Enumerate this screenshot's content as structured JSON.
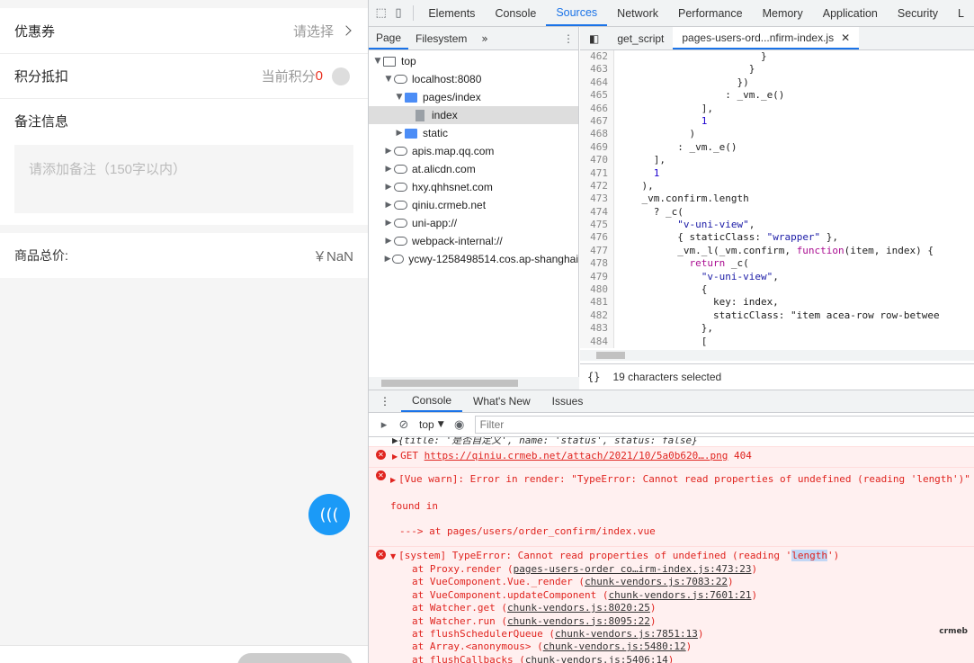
{
  "app": {
    "coupon": {
      "label": "优惠券",
      "value": "请选择"
    },
    "points": {
      "label": "积分抵扣",
      "prefix": "当前积分",
      "value": "0"
    },
    "remark": {
      "title": "备注信息",
      "placeholder": "请添加备注（150字以内）"
    },
    "total": {
      "label": "商品总价:",
      "value": "￥NaN"
    }
  },
  "devtools": {
    "tabs": [
      "Elements",
      "Console",
      "Sources",
      "Network",
      "Performance",
      "Memory",
      "Application",
      "Security",
      "L"
    ],
    "navigator": {
      "tabs": [
        "Page",
        "Filesystem"
      ],
      "tree": [
        {
          "label": "top",
          "depth": 0,
          "icon": "frame",
          "arrow": "▼"
        },
        {
          "label": "localhost:8080",
          "depth": 1,
          "icon": "cloud",
          "arrow": "▼"
        },
        {
          "label": "pages/index",
          "depth": 2,
          "icon": "folder",
          "arrow": "▼"
        },
        {
          "label": "index",
          "depth": 3,
          "icon": "file",
          "arrow": "",
          "selected": true
        },
        {
          "label": "static",
          "depth": 2,
          "icon": "folder",
          "arrow": "▶"
        },
        {
          "label": "apis.map.qq.com",
          "depth": 1,
          "icon": "cloud",
          "arrow": "▶"
        },
        {
          "label": "at.alicdn.com",
          "depth": 1,
          "icon": "cloud",
          "arrow": "▶"
        },
        {
          "label": "hxy.qhhsnet.com",
          "depth": 1,
          "icon": "cloud",
          "arrow": "▶"
        },
        {
          "label": "qiniu.crmeb.net",
          "depth": 1,
          "icon": "cloud",
          "arrow": "▶"
        },
        {
          "label": "uni-app://",
          "depth": 1,
          "icon": "cloud",
          "arrow": "▶"
        },
        {
          "label": "webpack-internal://",
          "depth": 1,
          "icon": "cloud",
          "arrow": "▶"
        },
        {
          "label": "ycwy-1258498514.cos.ap-shanghai",
          "depth": 1,
          "icon": "cloud",
          "arrow": "▶"
        }
      ]
    },
    "editor": {
      "tabs": [
        "get_script",
        "pages-users-ord...nfirm-index.js"
      ],
      "lines": [
        {
          "n": "462",
          "t": "                        }"
        },
        {
          "n": "463",
          "t": "                      }"
        },
        {
          "n": "464",
          "t": "                    })"
        },
        {
          "n": "465",
          "t": "                  : _vm._e()"
        },
        {
          "n": "466",
          "t": "              ],"
        },
        {
          "n": "467",
          "t": "              1"
        },
        {
          "n": "468",
          "t": "            )"
        },
        {
          "n": "469",
          "t": "          : _vm._e()"
        },
        {
          "n": "470",
          "t": "      ],"
        },
        {
          "n": "471",
          "t": "      1"
        },
        {
          "n": "472",
          "t": "    ),"
        },
        {
          "n": "473",
          "t": "    _vm.confirm.length"
        },
        {
          "n": "474",
          "t": "      ? _c("
        },
        {
          "n": "475",
          "t": "          \"v-uni-view\","
        },
        {
          "n": "476",
          "t": "          { staticClass: \"wrapper\" },"
        },
        {
          "n": "477",
          "t": "          _vm._l(_vm.confirm, function(item, index) {"
        },
        {
          "n": "478",
          "t": "            return _c("
        },
        {
          "n": "479",
          "t": "              \"v-uni-view\","
        },
        {
          "n": "480",
          "t": "              {"
        },
        {
          "n": "481",
          "t": "                key: index,"
        },
        {
          "n": "482",
          "t": "                staticClass: \"item acea-row row-betwee"
        },
        {
          "n": "483",
          "t": "              },"
        },
        {
          "n": "484",
          "t": "              ["
        }
      ],
      "status": "19 characters selected",
      "status_icon": "{}"
    },
    "drawer": {
      "tabs": [
        "Console",
        "What's New",
        "Issues"
      ],
      "context": "top",
      "filter_placeholder": "Filter",
      "messages": {
        "m0": "▶{title: '是否自定义', name: 'status', status: false}",
        "m1_pre": "GET ",
        "m1_url": "https://qiniu.crmeb.net/attach/2021/10/5a0b620….png",
        "m1_post": " 404",
        "m2": "[Vue warn]: Error in render: \"TypeError: Cannot read properties of undefined (reading 'length')\"",
        "m2b": "found in",
        "m2c": "---> at pages/users/order_confirm/index.vue",
        "m3_pre": "[system] TypeError: Cannot read properties of undefined (reading '",
        "m3_hl": "length",
        "m3_post": "')",
        "stack": [
          {
            "fn": "at Proxy.render (",
            "loc": "pages-users-order co…irm-index.js:473:23",
            "end": ")"
          },
          {
            "fn": "at VueComponent.Vue._render (",
            "loc": "chunk-vendors.js:7083:22",
            "end": ")"
          },
          {
            "fn": "at VueComponent.updateComponent (",
            "loc": "chunk-vendors.js:7601:21",
            "end": ")"
          },
          {
            "fn": "at Watcher.get (",
            "loc": "chunk-vendors.js:8020:25",
            "end": ")"
          },
          {
            "fn": "at Watcher.run (",
            "loc": "chunk-vendors.js:8095:22",
            "end": ")"
          },
          {
            "fn": "at flushSchedulerQueue (",
            "loc": "chunk-vendors.js:7851:13",
            "end": ")"
          },
          {
            "fn": "at Array.<anonymous> (",
            "loc": "chunk-vendors.js:5480:12",
            "end": ")"
          },
          {
            "fn": "at flushCallbacks (",
            "loc": "chunk-vendors.js:5406:14",
            "end": ")"
          }
        ]
      },
      "watermark": "crmeb"
    }
  }
}
